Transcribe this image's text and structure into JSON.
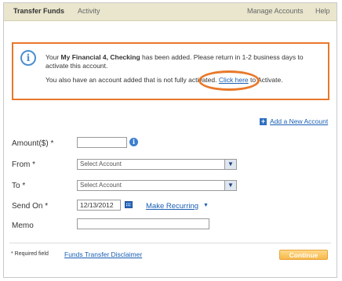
{
  "nav": {
    "transfer_funds": "Transfer Funds",
    "activity": "Activity",
    "manage_accounts": "Manage Accounts",
    "help": "Help"
  },
  "notice": {
    "line1_prefix": "Your ",
    "account_name": "My Financial 4, Checking",
    "line1_suffix": "  has been added. Please return in 1-2 business days to",
    "line2": "activate this account.",
    "line3_prefix": "You also have an account added that is not fully activated. ",
    "link_text": "Click here",
    "line3_suffix": " to Activate.",
    "accent_color": "#e8782a"
  },
  "add_account": {
    "label": "Add a New Account",
    "icon": "plus-icon"
  },
  "form": {
    "amount_label": "Amount($) *",
    "amount_value": "",
    "from_label": "From *",
    "from_value": "Select Account",
    "to_label": "To *",
    "to_value": "Select Account",
    "send_on_label": "Send On *",
    "send_on_value": "12/13/2012",
    "make_recurring": "Make Recurring",
    "memo_label": "Memo",
    "memo_value": ""
  },
  "footer": {
    "required_note": "* Required field",
    "disclaimer_link": "Funds Transfer Disclaimer",
    "continue_label": "Continue"
  }
}
